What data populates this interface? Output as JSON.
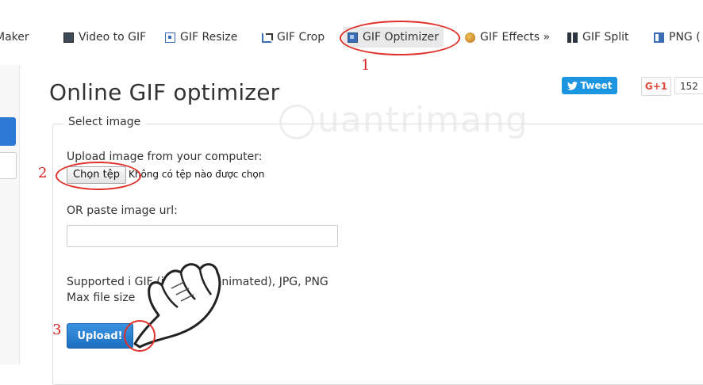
{
  "nav": {
    "items": [
      {
        "label": "Maker",
        "icon": ""
      },
      {
        "label": "Video to GIF",
        "icon": "film-icon"
      },
      {
        "label": "GIF Resize",
        "icon": "resize-icon"
      },
      {
        "label": "GIF Crop",
        "icon": "crop-icon"
      },
      {
        "label": "GIF Optimizer",
        "icon": "optimizer-icon"
      },
      {
        "label": "GIF Effects »",
        "icon": "effects-icon"
      },
      {
        "label": "GIF Split",
        "icon": "split-icon"
      },
      {
        "label": "PNG (",
        "icon": "png-icon"
      }
    ],
    "active": "GIF Optimizer"
  },
  "page": {
    "title": "Online GIF optimizer"
  },
  "social": {
    "tweet_label": "Tweet",
    "gplus_label": "G+1",
    "gplus_count": "152"
  },
  "form": {
    "legend": "Select image",
    "upload_label": "Upload image from your computer:",
    "file_button": "Chọn tệp",
    "file_status": "Không có tệp nào được chọn",
    "url_label": "OR paste image url:",
    "url_value": "",
    "supported_line1": "Supported i                  GIF (including animated), JPG, PNG",
    "supported_line2": "Max file size",
    "upload_button": "Upload!"
  },
  "annotations": {
    "step1": "1",
    "step2": "2",
    "step3": "3",
    "color": "#e0302a"
  },
  "watermark": {
    "text": "uantrimang"
  },
  "colors": {
    "accent": "#1d6fc1",
    "tweet": "#1b95e0",
    "gplus": "#dd4b39"
  }
}
